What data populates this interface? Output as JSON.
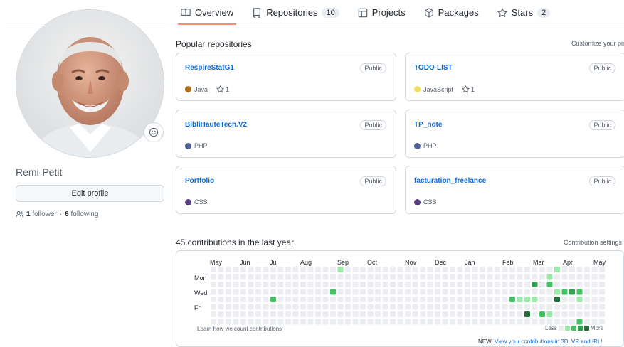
{
  "nav": {
    "tabs": [
      {
        "label": "Overview",
        "icon": "book-icon"
      },
      {
        "label": "Repositories",
        "count": "10",
        "icon": "repo-icon"
      },
      {
        "label": "Projects",
        "icon": "table-icon"
      },
      {
        "label": "Packages",
        "icon": "package-icon"
      },
      {
        "label": "Stars",
        "count": "2",
        "icon": "star-icon"
      }
    ]
  },
  "profile": {
    "username": "Remi-Petit",
    "edit_label": "Edit profile",
    "followers": "1",
    "followers_label": "follower",
    "separator": "·",
    "following": "6",
    "following_label": "following"
  },
  "popular": {
    "title": "Popular repositories",
    "customize": "Customize your pins",
    "repos": [
      {
        "name": "RespireStatG1",
        "visibility": "Public",
        "language": "Java",
        "lang_color": "#b07219",
        "stars": "1"
      },
      {
        "name": "TODO-LIST",
        "visibility": "Public",
        "language": "JavaScript",
        "lang_color": "#f1e05a",
        "stars": "1"
      },
      {
        "name": "BibliHauteTech.V2",
        "visibility": "Public",
        "language": "PHP",
        "lang_color": "#4F5D95"
      },
      {
        "name": "TP_note",
        "visibility": "Public",
        "language": "PHP",
        "lang_color": "#4F5D95"
      },
      {
        "name": "Portfolio",
        "visibility": "Public",
        "language": "CSS",
        "lang_color": "#563d7c"
      },
      {
        "name": "facturation_freelance",
        "visibility": "Public",
        "language": "CSS",
        "lang_color": "#563d7c"
      }
    ]
  },
  "contributions": {
    "title": "45 contributions in the last year",
    "settings": "Contribution settings ▾",
    "months": [
      "May",
      "Jun",
      "Jul",
      "Aug",
      "Sep",
      "Oct",
      "Nov",
      "Dec",
      "Jan",
      "Feb",
      "Mar",
      "Apr",
      "May"
    ],
    "days": [
      "Mon",
      "Wed",
      "Fri"
    ],
    "learn": "Learn how we count contributions",
    "less": "Less",
    "more": "More",
    "new_prefix": "NEW!",
    "new_link": "View your contributions in 3D, VR and IRL!",
    "colors": [
      "#ebedf0",
      "#9be9a8",
      "#40c463",
      "#30a14e",
      "#216e39"
    ],
    "active_cells": [
      {
        "week": 17,
        "day": 0,
        "level": 1
      },
      {
        "week": 16,
        "day": 3,
        "level": 2
      },
      {
        "week": 8,
        "day": 4,
        "level": 2
      },
      {
        "week": 40,
        "day": 4,
        "level": 2
      },
      {
        "week": 41,
        "day": 4,
        "level": 1
      },
      {
        "week": 42,
        "day": 4,
        "level": 1
      },
      {
        "week": 43,
        "day": 4,
        "level": 1
      },
      {
        "week": 42,
        "day": 6,
        "level": 4
      },
      {
        "week": 44,
        "day": 6,
        "level": 2
      },
      {
        "week": 43,
        "day": 2,
        "level": 3
      },
      {
        "week": 45,
        "day": 2,
        "level": 2
      },
      {
        "week": 46,
        "day": 0,
        "level": 1
      },
      {
        "week": 45,
        "day": 1,
        "level": 1
      },
      {
        "week": 46,
        "day": 3,
        "level": 1
      },
      {
        "week": 47,
        "day": 3,
        "level": 2
      },
      {
        "week": 46,
        "day": 4,
        "level": 4
      },
      {
        "week": 48,
        "day": 3,
        "level": 3
      },
      {
        "week": 49,
        "day": 3,
        "level": 2
      },
      {
        "week": 49,
        "day": 4,
        "level": 1
      },
      {
        "week": 45,
        "day": 6,
        "level": 1
      },
      {
        "week": 49,
        "day": 7,
        "level": 2
      }
    ]
  }
}
